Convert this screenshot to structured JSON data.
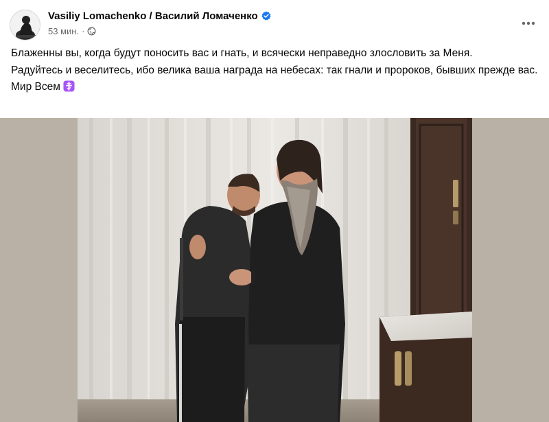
{
  "post": {
    "author": {
      "name": "Vasiliy Lomachenko / Василий Ломаченко",
      "verified_icon": "verified-badge-icon",
      "avatar_icon": "profile-avatar"
    },
    "meta": {
      "time": "53 мин.",
      "separator": "·",
      "audience_icon": "globe-icon"
    },
    "menu_icon": "more-options-icon",
    "text": {
      "line1": "Блаженны вы, когда будут поносить вас и гнать, и всячески неправедно злословить за Меня.",
      "line2": "Радуйтесь и веселитесь, ибо велика ваша награда на небесах: так гнали и пророков, бывших прежде вас.",
      "line3": "Мир Всем",
      "emoji_icon": "orthodox-cross-emoji-icon"
    },
    "photo": {
      "subject": "photo"
    }
  },
  "colors": {
    "verified_blue": "#1877f2",
    "secondary_text": "#65676b",
    "cross_emoji_purple": "#a855f7"
  }
}
